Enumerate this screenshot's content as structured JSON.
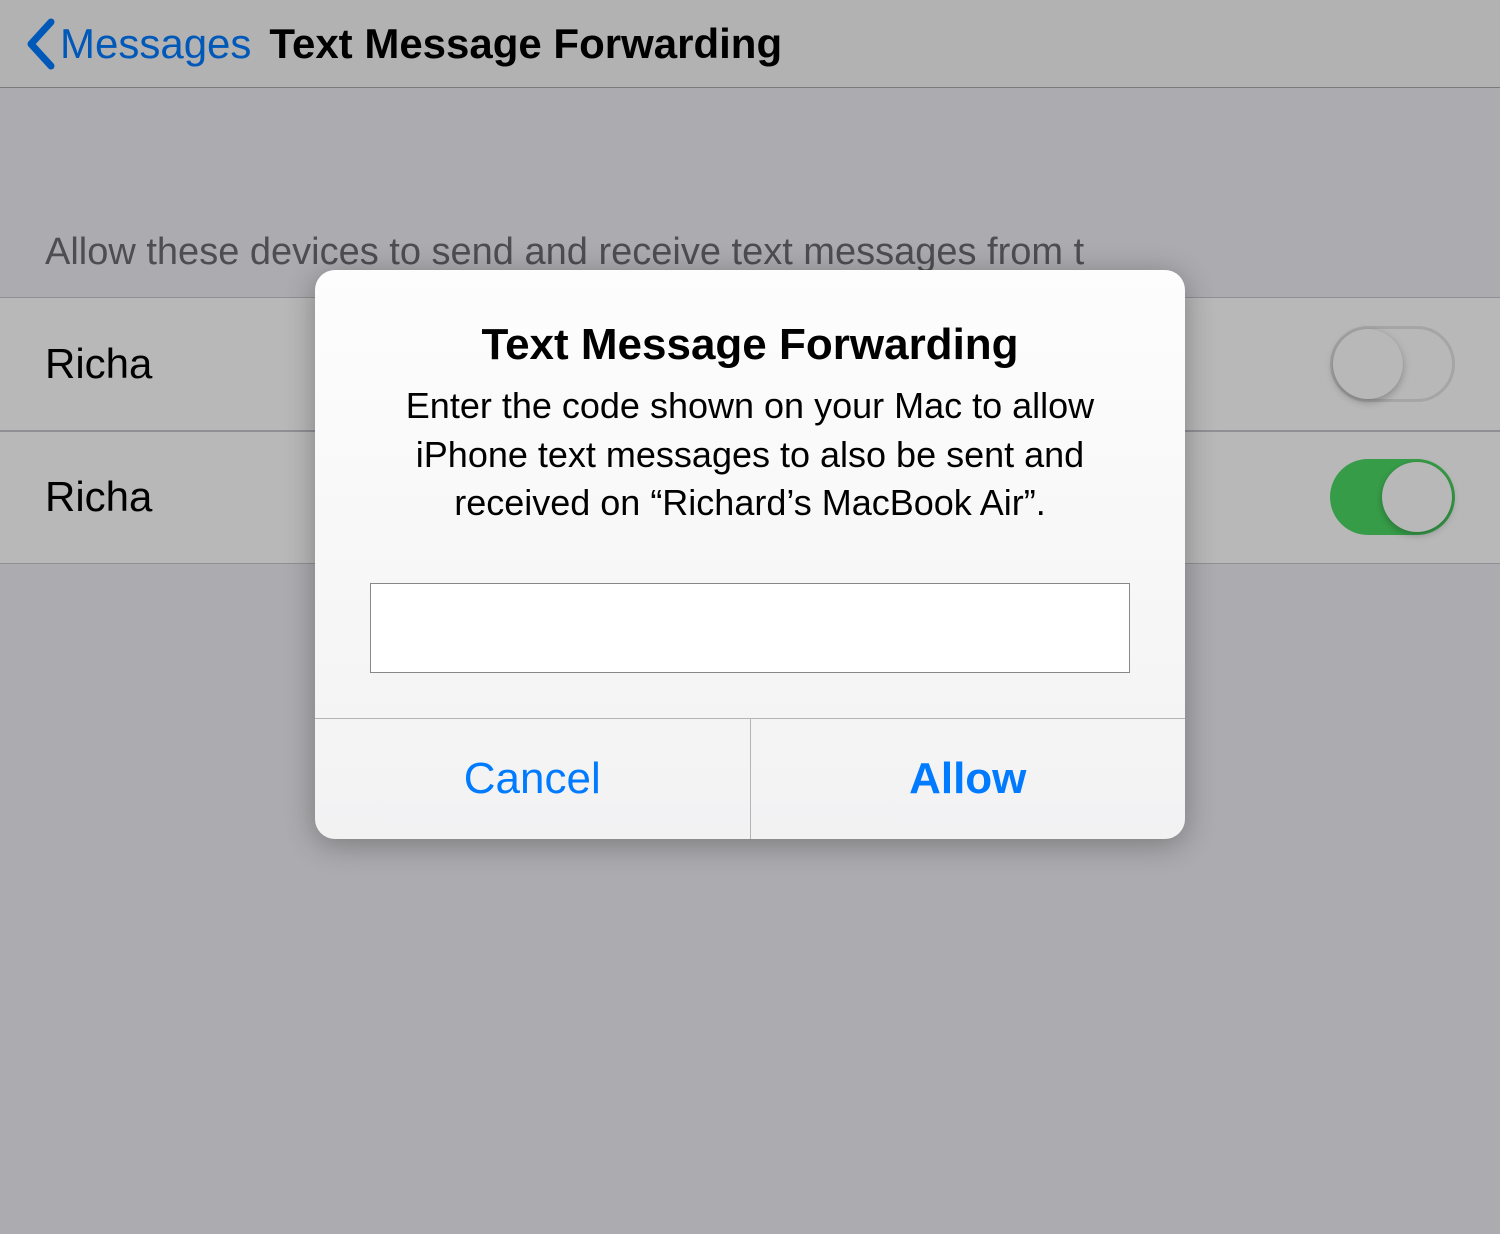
{
  "nav": {
    "back_label": "Messages",
    "title": "Text Message Forwarding"
  },
  "section": {
    "header": "Allow these devices to send and receive text messages from t"
  },
  "devices": [
    {
      "name": "Richa",
      "enabled": false
    },
    {
      "name": "Richa",
      "enabled": true
    }
  ],
  "modal": {
    "title": "Text Message Forwarding",
    "message": "Enter the code shown on your Mac to allow iPhone text messages to also be sent and received on “Richard’s MacBook Air”.",
    "input_value": "",
    "cancel_label": "Cancel",
    "allow_label": "Allow"
  }
}
